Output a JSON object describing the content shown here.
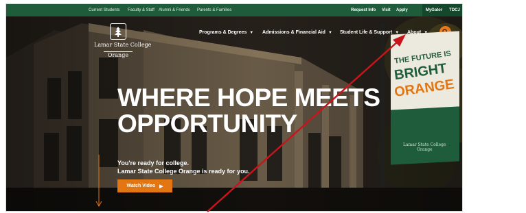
{
  "utility_bar": {
    "audiences": [
      "Current Students",
      "Faculty & Staff",
      "Alumni & Friends",
      "Parents & Families"
    ],
    "quick_links": [
      "Request Info",
      "Visit",
      "Apply"
    ],
    "mygator": "MyGator",
    "tdcj": "TDCJ"
  },
  "logo": {
    "line1": "Lamar State College",
    "line2": "Orange"
  },
  "nav": {
    "items": [
      "Programs & Degrees",
      "Admissions & Financial Aid",
      "Student Life & Support",
      "About"
    ],
    "caret": "▼"
  },
  "hero": {
    "headline_line1": "WHERE HOPE MEETS",
    "headline_line2": "OPPORTUNITY",
    "sub_line1": "You're ready for college.",
    "sub_line2": "Lamar State College Orange is ready for you.",
    "watch_video": "Watch Video",
    "play_glyph": "▶"
  },
  "banner": {
    "line1": "THE FUTURE IS",
    "line2": "BRIGHT",
    "line3": "ORANGE",
    "logo_line1": "Lamar State College",
    "logo_line2": "Orange"
  },
  "colors": {
    "green": "#1f5c3b",
    "orange": "#e27613",
    "annotation_red": "#c8151b"
  }
}
